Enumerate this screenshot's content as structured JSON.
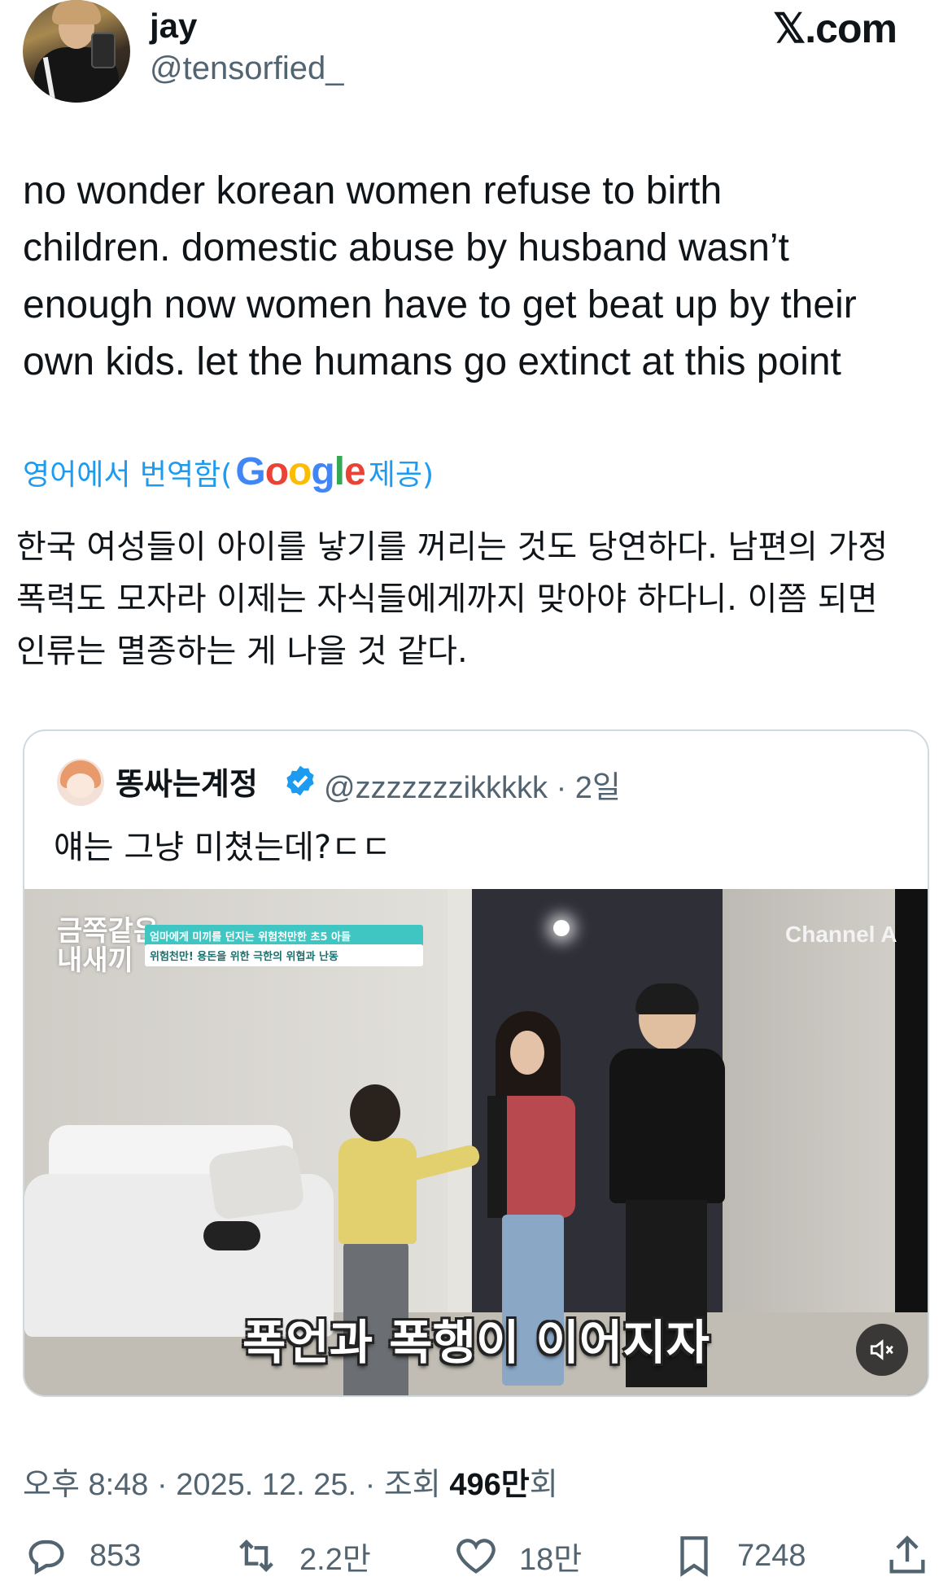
{
  "header": {
    "display_name": "jay",
    "handle": "@tensorfied_",
    "site": "𝕏.com"
  },
  "post": {
    "text": "no wonder korean women refuse to birth\nchildren. domestic abuse by husband wasn’t\nenough now women have to get beat up by their\nown kids. let the humans go extinct at this point",
    "translate_label": "영어에서 번역함(",
    "translate_provider": "Google",
    "translate_suffix": " 제공)",
    "translated_text": "한국 여성들이 아이를 낳기를 꺼리는 것도 당연하다. 남편의 가정\n폭력도 모자라 이제는 자식들에게까지 맞아야 하다니. 이쯤 되면\n인류는 멸종하는 게 나을 것 같다."
  },
  "quote": {
    "display_name": "똥싸는계정",
    "handle_and_time": "@zzzzzzzikkkkk · 2일",
    "text": "얘는 그냥 미쳤는데?ㄷㄷ",
    "video": {
      "show_logo": "금쪽같은\n내새끼",
      "caption_line1": "엄마에게 미끼를 던지는 위험천만한 초5 아들",
      "caption_line2": "위험천만! 용돈을 위한 극한의 위협과 난동",
      "channel": "Channel A",
      "subtitle": "폭언과 폭행이 이어지자",
      "muted": true
    }
  },
  "meta": {
    "time_date": "오후 8:48 · 2025. 12. 25. · 조회 ",
    "views": "496만",
    "views_suffix": "회"
  },
  "actions": {
    "replies": "853",
    "reposts": "2.2만",
    "likes": "18만",
    "bookmarks": "7248"
  },
  "colors": {
    "link": "#1d9bf0",
    "secondary": "#536471",
    "border": "#cfd9de"
  }
}
